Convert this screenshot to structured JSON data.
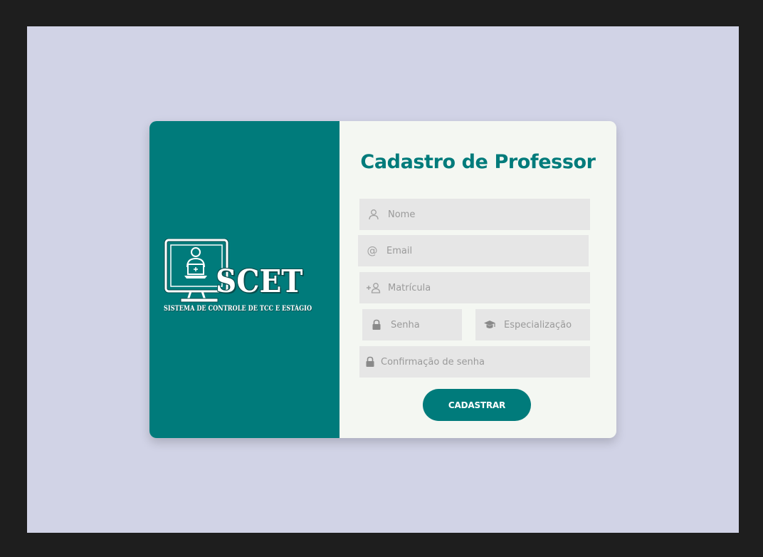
{
  "brand": {
    "logo_word": "SCET",
    "logo_subtitle": "SISTEMA DE CONTROLE DE TCC  E ESTÁGIO"
  },
  "form": {
    "title": "Cadastro de Professor",
    "fields": {
      "nome": {
        "placeholder": "Nome",
        "value": "",
        "icon": "user-icon"
      },
      "email": {
        "placeholder": "Email",
        "value": "",
        "icon": "at-icon"
      },
      "matricula": {
        "placeholder": "Matrícula",
        "value": "",
        "icon": "add-user-icon"
      },
      "senha": {
        "placeholder": "Senha",
        "value": "",
        "icon": "lock-icon"
      },
      "especializacao": {
        "placeholder": "Especialização",
        "value": "",
        "icon": "graduation-cap-icon"
      },
      "confirmacao": {
        "placeholder": "Confirmação de senha",
        "value": "",
        "icon": "lock-icon"
      }
    },
    "submit_label": "CADASTRAR"
  },
  "colors": {
    "background": "#d1d3e6",
    "accent": "#007b7b",
    "card": "#f4f7f2",
    "field": "#e6e6e6",
    "frame": "#1e1e1e"
  }
}
